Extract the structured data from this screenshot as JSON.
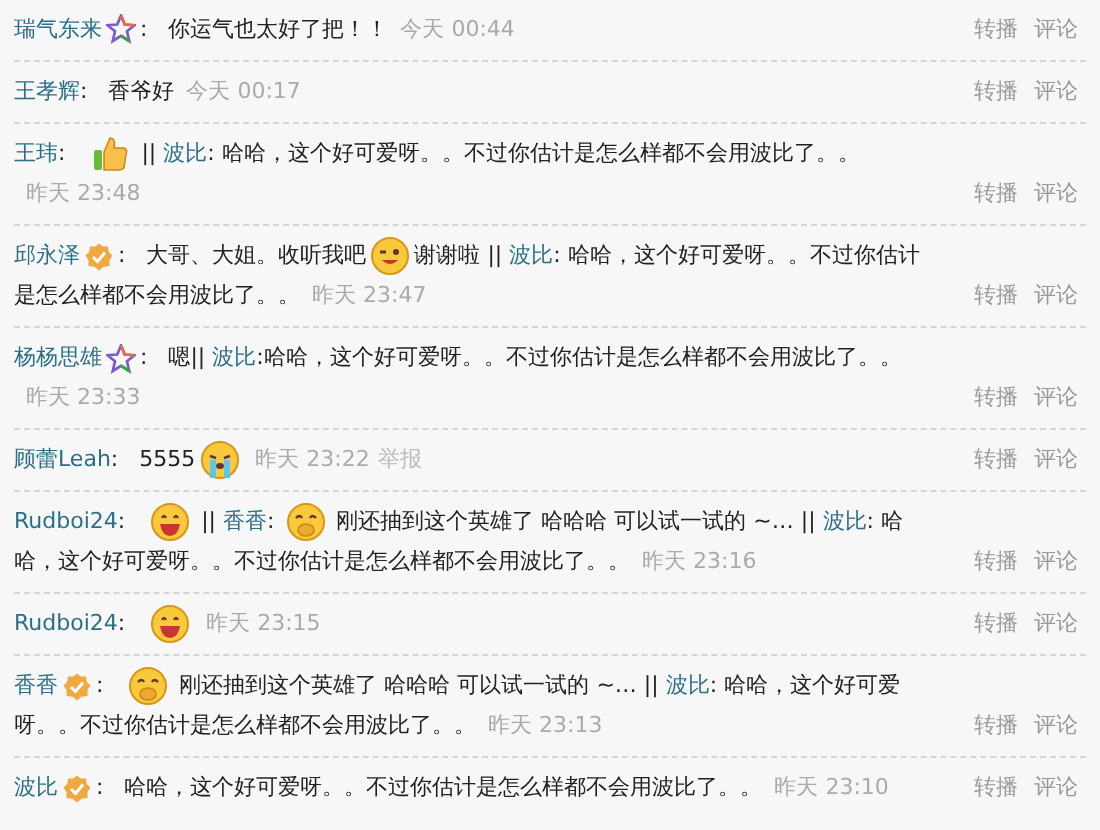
{
  "comments": [
    {
      "author": "瑞气东来",
      "kind": "star",
      "separator": ":",
      "body": [
        {
          "kind": "text",
          "text": "你运气也太好了把！！"
        }
      ],
      "time": "今天 00:44",
      "actions": [
        "转播",
        "评论"
      ]
    },
    {
      "author": "王孝辉",
      "kind": "plain",
      "separator": ":",
      "body": [
        {
          "kind": "text",
          "text": "香爷好"
        }
      ],
      "time": "今天 00:17",
      "actions": [
        "转播",
        "评论"
      ]
    },
    {
      "author": "王玮",
      "kind": "plain",
      "separator": ":",
      "body": [
        {
          "kind": "thumbs-up"
        },
        {
          "kind": "text",
          "text": " || "
        },
        {
          "kind": "mention",
          "text": "波比"
        },
        {
          "kind": "text",
          "text": ": 哈哈，这个好可爱呀。。不过你估计是怎么样都不会用波比了。。"
        }
      ],
      "time": "昨天 23:48",
      "actions": [
        "转播",
        "评论"
      ]
    },
    {
      "author": "邱永泽",
      "kind": "verified",
      "separator": ":",
      "body": [
        {
          "kind": "text",
          "text": "大哥、大姐。收听我吧"
        },
        {
          "kind": "wink"
        },
        {
          "kind": "text",
          "text": "谢谢啦 || "
        },
        {
          "kind": "mention",
          "text": "波比"
        },
        {
          "kind": "text",
          "text": ": 哈哈，这个好可爱呀。。不过你估计是怎么样都不会用波比了。。"
        }
      ],
      "time": "昨天 23:47",
      "actions": [
        "转播",
        "评论"
      ]
    },
    {
      "author": "杨杨思雄",
      "kind": "star",
      "separator": ":",
      "body": [
        {
          "kind": "text",
          "text": "嗯|| "
        },
        {
          "kind": "mention",
          "text": "波比"
        },
        {
          "kind": "text",
          "text": ":哈哈，这个好可爱呀。。不过你估计是怎么样都不会用波比了。。"
        }
      ],
      "time": "昨天 23:33",
      "actions": [
        "转播",
        "评论"
      ]
    },
    {
      "author": "顾蕾Leah",
      "kind": "plain",
      "separator": ":",
      "body": [
        {
          "kind": "text",
          "text": "5555"
        },
        {
          "kind": "cry"
        }
      ],
      "time": "昨天 23:22",
      "report": "举报",
      "actions": [
        "转播",
        "评论"
      ]
    },
    {
      "author": "Rudboi24",
      "kind": "plain",
      "separator": ":",
      "body": [
        {
          "kind": "grin"
        },
        {
          "kind": "text",
          "text": " || "
        },
        {
          "kind": "mention",
          "text": "香香"
        },
        {
          "kind": "text",
          "text": ": "
        },
        {
          "kind": "giggle"
        },
        {
          "kind": "text",
          "text": " 刚还抽到这个英雄了 哈哈哈 可以试一试的 ~… || "
        },
        {
          "kind": "mention",
          "text": "波比"
        },
        {
          "kind": "text",
          "text": ": 哈哈，这个好可爱呀。。不过你估计是怎么样都不会用波比了。。"
        }
      ],
      "time": "昨天 23:16",
      "actions": [
        "转播",
        "评论"
      ]
    },
    {
      "author": "Rudboi24",
      "kind": "plain",
      "separator": ":",
      "body": [
        {
          "kind": "grin"
        }
      ],
      "time": "昨天 23:15",
      "actions": [
        "转播",
        "评论"
      ]
    },
    {
      "author": "香香",
      "kind": "verified",
      "separator": ":",
      "body": [
        {
          "kind": "giggle"
        },
        {
          "kind": "text",
          "text": " 刚还抽到这个英雄了 哈哈哈 可以试一试的 ~… || "
        },
        {
          "kind": "mention",
          "text": "波比"
        },
        {
          "kind": "text",
          "text": ": 哈哈，这个好可爱呀。。不过你估计是怎么样都不会用波比了。。"
        }
      ],
      "time": "昨天 23:13",
      "actions": [
        "转播",
        "评论"
      ]
    },
    {
      "author": "波比",
      "kind": "verified",
      "separator": ":",
      "body": [
        {
          "kind": "text",
          "text": "哈哈，这个好可爱呀。。不过你估计是怎么样都不会用波比了。。"
        }
      ],
      "time": "昨天 23:10",
      "actions": [
        "转播",
        "评论"
      ]
    }
  ]
}
